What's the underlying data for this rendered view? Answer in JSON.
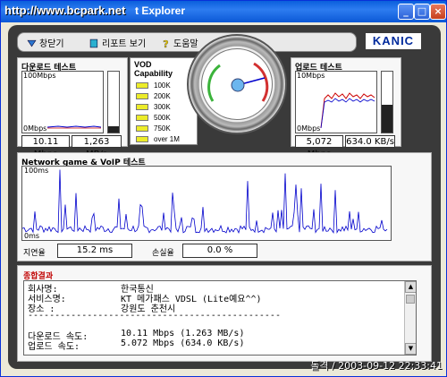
{
  "window": {
    "title": "t Explorer",
    "title_overlay": "http://www.bcpark.net",
    "controls": [
      "_",
      "□",
      "×"
    ]
  },
  "toolbar": {
    "close_label": "창닫기",
    "report_label": "리포트 보기",
    "help_label": "도움말",
    "logo": "KANIC"
  },
  "download": {
    "title": "다운로드 테스트",
    "max_label": "100Mbps",
    "min_label": "0Mbps",
    "mbps": "10.11 Mbps",
    "mbytes": "1,263 MB/s",
    "level": 0.1
  },
  "upload": {
    "title": "업로드 테스트",
    "max_label": "10Mbps",
    "min_label": "0Mbps",
    "mbps": "5,072 Mbps",
    "kbytes": "634.0 KB/s",
    "level": 0.45
  },
  "vod": {
    "title_line1": "VOD",
    "title_line2": "Capability",
    "levels": [
      "100K",
      "200K",
      "300K",
      "500K",
      "750K",
      "over 1M"
    ]
  },
  "network": {
    "title": "Network game & VoIP 테스트",
    "max_label": "100ms",
    "min_label": "0ms",
    "latency_label": "지연율",
    "latency_value": "15.2 ms",
    "loss_label": "손실율",
    "loss_value": "0.0 %"
  },
  "result": {
    "title": "종합결과",
    "rows": [
      {
        "label": "회사명:",
        "value": "한국통신"
      },
      {
        "label": "서비스명:",
        "value": "KT 메가패스 VDSL (Lite예요^^)"
      },
      {
        "label": "장소 :",
        "value": "강원도 춘천시"
      },
      {
        "label": "-----------------------------------------------",
        "value": ""
      },
      {
        "label": "",
        "value": ""
      },
      {
        "label": "다운로드 속도:",
        "value": "10.11 Mbps (1.263 MB/s)"
      },
      {
        "label": "업로드 속도:",
        "value": "5.072 Mbps (634.0 KB/s)"
      }
    ]
  },
  "watermark": "돌격 / 2003-09-12 22:33:41",
  "colors": {
    "accent": "#0000cc",
    "upload_line": "#cc0000",
    "title": "#0a5fdc"
  },
  "icons": [
    "close-window-icon",
    "report-icon",
    "help-icon"
  ]
}
